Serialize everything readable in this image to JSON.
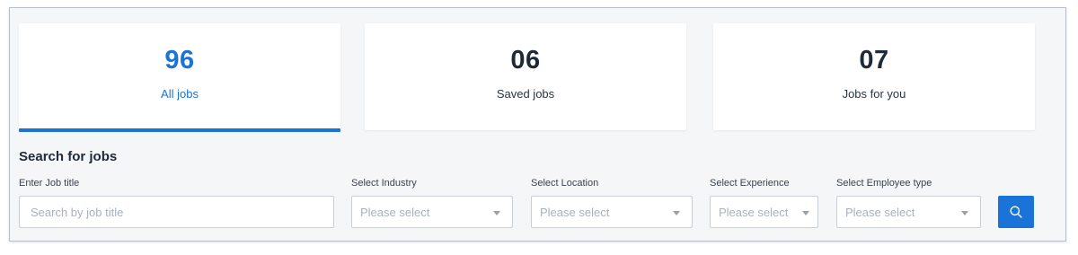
{
  "stats": [
    {
      "value": "96",
      "label": "All jobs"
    },
    {
      "value": "06",
      "label": "Saved jobs"
    },
    {
      "value": "07",
      "label": "Jobs for you"
    }
  ],
  "search": {
    "title": "Search for jobs",
    "job_title": {
      "label": "Enter Job title",
      "placeholder": "Search by job title",
      "value": ""
    },
    "industry": {
      "label": "Select Industry",
      "value": "Please select"
    },
    "location": {
      "label": "Select Location",
      "value": "Please select"
    },
    "experience": {
      "label": "Select Experience",
      "value": "Please select"
    },
    "employee_type": {
      "label": "Select Employee type",
      "value": "Please select"
    },
    "button_icon": "search-icon"
  },
  "colors": {
    "accent": "#1a73d9",
    "panel_bg": "#f5f6f8",
    "text": "#1f2a37"
  }
}
